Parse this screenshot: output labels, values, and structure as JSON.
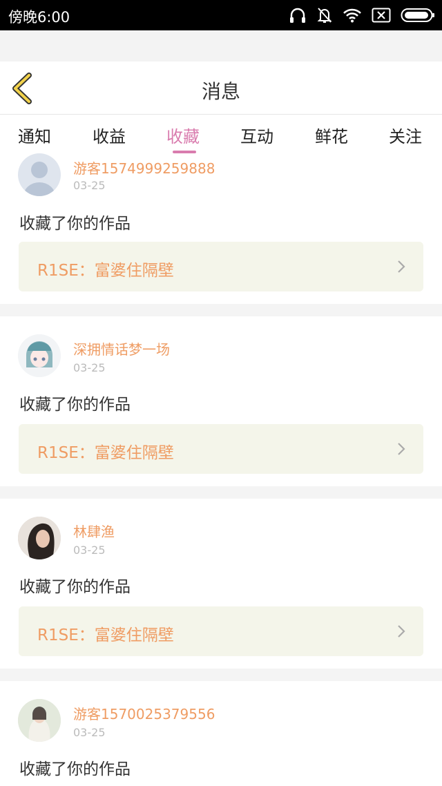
{
  "status_bar": {
    "time": "傍晚6:00",
    "icons": [
      "headphones-icon",
      "bell-off-icon",
      "wifi-icon",
      "sim-x-icon",
      "battery-icon"
    ]
  },
  "header": {
    "title": "消息"
  },
  "tabs": [
    {
      "label": "通知"
    },
    {
      "label": "收益"
    },
    {
      "label": "收藏",
      "active": true
    },
    {
      "label": "互动"
    },
    {
      "label": "鲜花"
    },
    {
      "label": "关注"
    }
  ],
  "items": [
    {
      "username": "游客1574999259888",
      "date": "03-25",
      "message": "收藏了你的作品",
      "work_title": "R1SE：富婆住隔壁"
    },
    {
      "username": "深拥情话梦一场",
      "date": "03-25",
      "message": "收藏了你的作品",
      "work_title": "R1SE：富婆住隔壁"
    },
    {
      "username": "林肆渔",
      "date": "03-25",
      "message": "收藏了你的作品",
      "work_title": "R1SE：富婆住隔壁"
    },
    {
      "username": "游客1570025379556",
      "date": "03-25",
      "message": "收藏了你的作品"
    }
  ],
  "colors": {
    "accent": "#d97cae",
    "username": "#ef9c63",
    "workbox_bg": "#f4f5ea",
    "back_arrow": "#f2d24b"
  }
}
